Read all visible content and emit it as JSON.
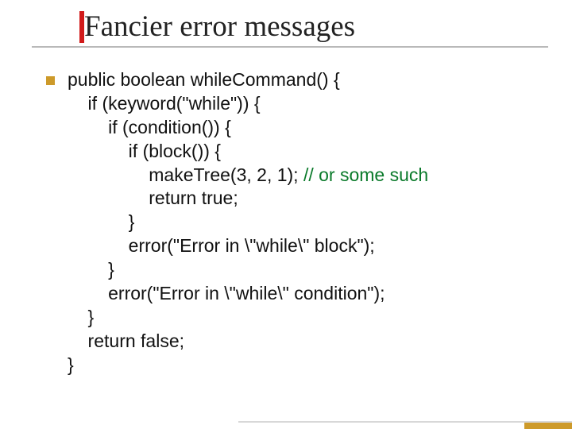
{
  "slide": {
    "title": "Fancier error messages",
    "bullet_icon": "square-bullet-icon",
    "code": {
      "l1": "public boolean whileCommand() {",
      "l2": "    if (keyword(\"while\")) {",
      "l3": "        if (condition()) {",
      "l4": "            if (block()) {",
      "l5a": "                makeTree(3, 2, 1);",
      "l5b": " // or some such",
      "l6": "                return true;",
      "l7": "            }",
      "l8": "            error(\"Error in \\\"while\\\" block\");",
      "l9": "        }",
      "l10": "        error(\"Error in \\\"while\\\" condition\");",
      "l11": "    }",
      "l12": "    return false;",
      "l13": "}"
    }
  }
}
